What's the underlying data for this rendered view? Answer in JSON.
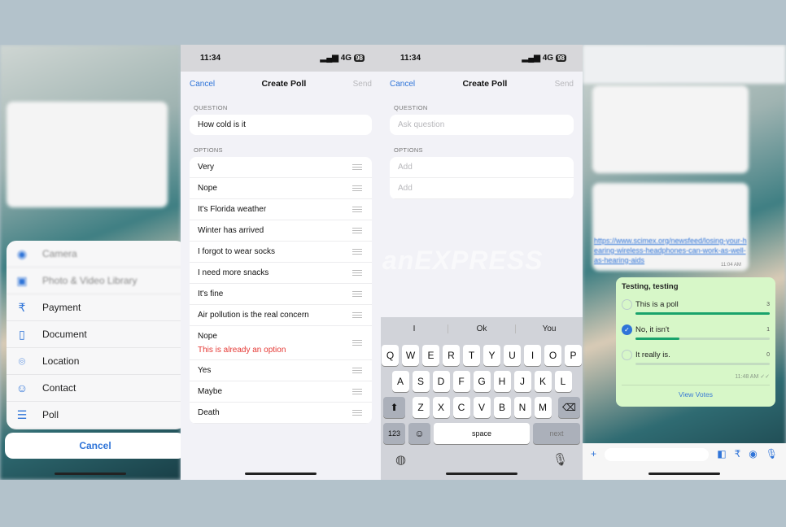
{
  "attach_sheet": {
    "items": [
      {
        "label": "Camera",
        "icon": "camera-icon"
      },
      {
        "label": "Photo & Video Library",
        "icon": "photo-icon"
      },
      {
        "label": "Payment",
        "icon": "rupee-icon"
      },
      {
        "label": "Document",
        "icon": "document-icon"
      },
      {
        "label": "Location",
        "icon": "location-pin-icon"
      },
      {
        "label": "Contact",
        "icon": "contact-icon"
      },
      {
        "label": "Poll",
        "icon": "poll-icon"
      }
    ],
    "cancel": "Cancel"
  },
  "status": {
    "time": "11:34",
    "network": "4G",
    "battery": "98"
  },
  "poll_filled": {
    "cancel": "Cancel",
    "title": "Create Poll",
    "send": "Send",
    "question_label": "QUESTION",
    "question": "How cold is it",
    "options_label": "OPTIONS",
    "options": [
      "Very",
      "Nope",
      "It's Florida weather",
      "Winter has arrived",
      "I forgot to wear socks",
      "I need more snacks",
      "It's fine",
      "Air pollution is the real concern",
      "Nope",
      "Yes",
      "Maybe",
      "Death"
    ],
    "error": "This is already an option"
  },
  "poll_empty": {
    "cancel": "Cancel",
    "title": "Create Poll",
    "send": "Send",
    "question_label": "QUESTION",
    "question_placeholder": "Ask question",
    "options_label": "OPTIONS",
    "option_placeholder": "Add"
  },
  "keyboard": {
    "suggestions": [
      "I",
      "Ok",
      "You"
    ],
    "row1": [
      "Q",
      "W",
      "E",
      "R",
      "T",
      "Y",
      "U",
      "I",
      "O",
      "P"
    ],
    "row2": [
      "A",
      "S",
      "D",
      "F",
      "G",
      "H",
      "J",
      "K",
      "L"
    ],
    "row3": [
      "Z",
      "X",
      "C",
      "V",
      "B",
      "N",
      "M"
    ],
    "numbers": "123",
    "space": "space",
    "next": "next"
  },
  "watermark": "anEXPRESS",
  "chat": {
    "link": "https://www.scimex.org/newsfeed/losing-your-hearing-wireless-headphones-can-work-as-well-as-hearing-aids",
    "link_time": "11:04 AM",
    "poll": {
      "question": "Testing, testing",
      "options": [
        {
          "label": "This is a poll",
          "votes": "3",
          "fraction": 1.0,
          "selected": false
        },
        {
          "label": "No, it isn't",
          "votes": "1",
          "fraction": 0.33,
          "selected": true
        },
        {
          "label": "It really is.",
          "votes": "0",
          "fraction": 0,
          "selected": false
        }
      ],
      "time": "11:48 AM",
      "view_votes": "View Votes"
    },
    "accent": "#1aa36c"
  }
}
